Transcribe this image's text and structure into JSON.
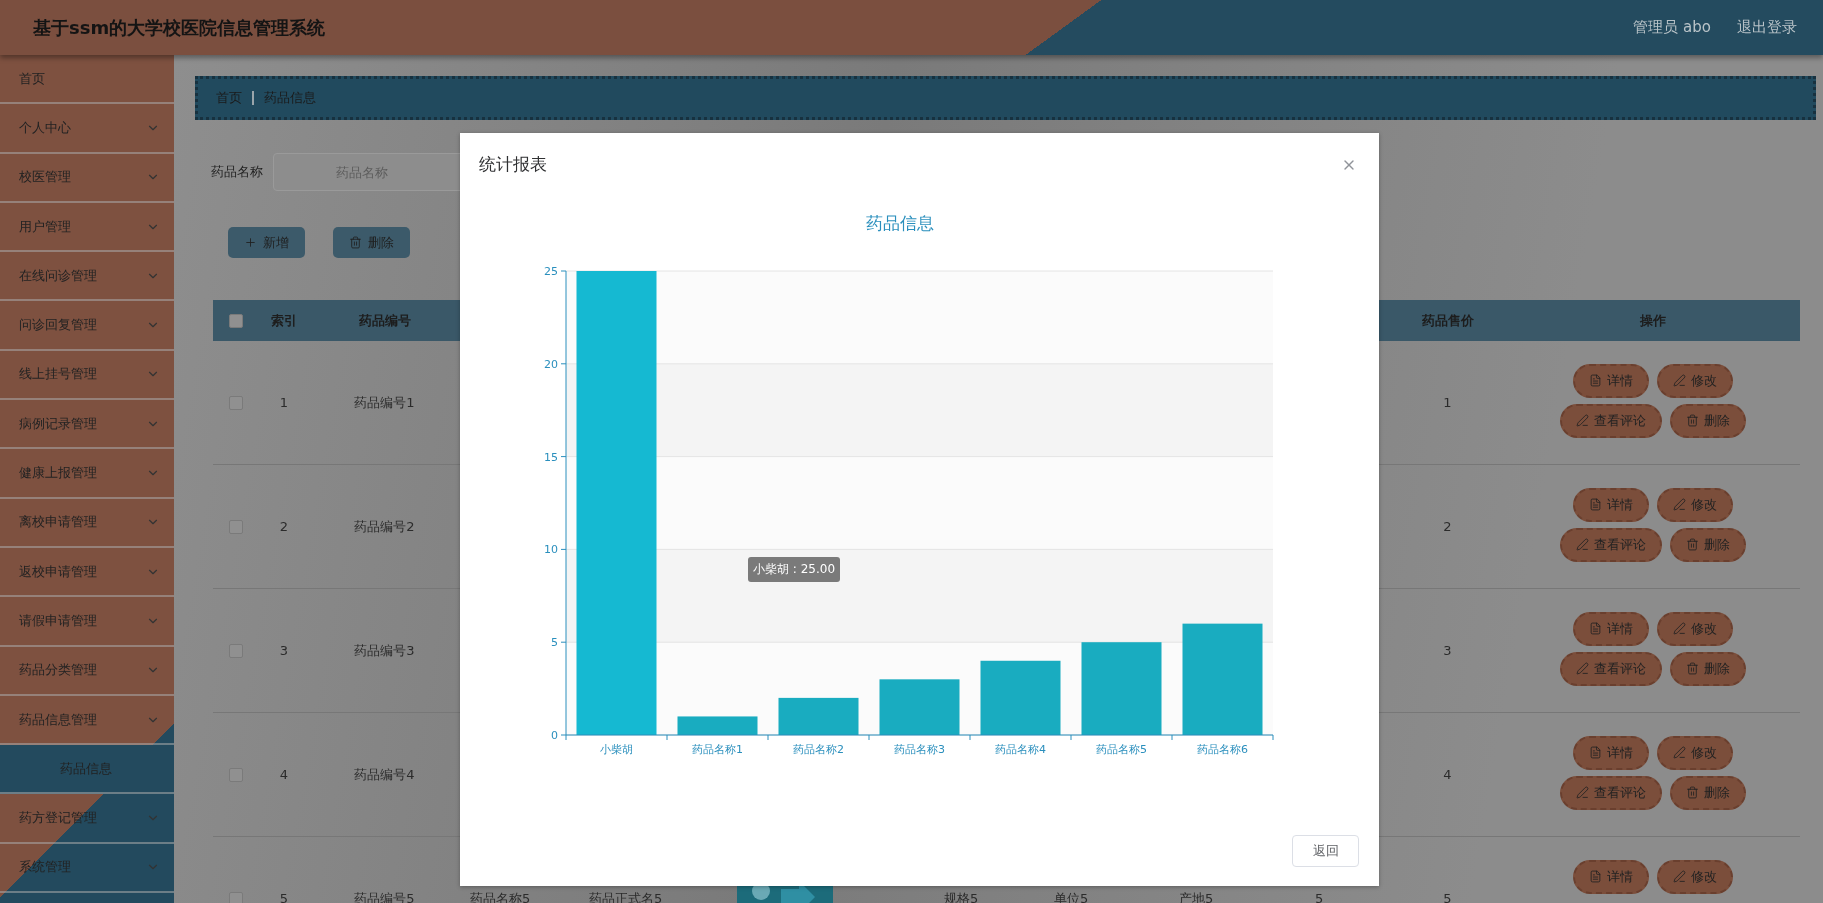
{
  "header": {
    "title": "基于ssm的大学校医院信息管理系统",
    "user": "管理员 abo",
    "logout": "退出登录"
  },
  "sidebar": {
    "items": [
      {
        "label": "首页",
        "kind": "link"
      },
      {
        "label": "个人中心",
        "kind": "menu"
      },
      {
        "label": "校医管理",
        "kind": "menu"
      },
      {
        "label": "用户管理",
        "kind": "menu"
      },
      {
        "label": "在线问诊管理",
        "kind": "menu"
      },
      {
        "label": "问诊回复管理",
        "kind": "menu"
      },
      {
        "label": "线上挂号管理",
        "kind": "menu"
      },
      {
        "label": "病例记录管理",
        "kind": "menu"
      },
      {
        "label": "健康上报管理",
        "kind": "menu"
      },
      {
        "label": "离校申请管理",
        "kind": "menu"
      },
      {
        "label": "返校申请管理",
        "kind": "menu"
      },
      {
        "label": "请假申请管理",
        "kind": "menu"
      },
      {
        "label": "药品分类管理",
        "kind": "menu"
      },
      {
        "label": "药品信息管理",
        "kind": "menu",
        "children": [
          {
            "label": "药品信息"
          }
        ]
      },
      {
        "label": "药方登记管理",
        "kind": "menu"
      },
      {
        "label": "系统管理",
        "kind": "menu"
      }
    ]
  },
  "breadcrumb": [
    "首页",
    "药品信息"
  ],
  "search": {
    "label": "药品名称",
    "placeholder": "药品名称"
  },
  "toolbar": [
    {
      "label": "新增",
      "kind": "add"
    },
    {
      "label": "删除",
      "kind": "delete"
    }
  ],
  "table": {
    "header_checked": false,
    "columns": {
      "index": "索引",
      "code": "药品编号",
      "price": "药品售价",
      "actions": "操作"
    },
    "rows": [
      {
        "checked": false,
        "index": "1",
        "code": "药品编号1",
        "price": "1",
        "actions": [
          {
            "label": "详情",
            "kind": "detail"
          },
          {
            "label": "修改",
            "kind": "edit"
          },
          {
            "label": "查看评论",
            "kind": "edit"
          },
          {
            "label": "删除",
            "kind": "delete"
          }
        ]
      },
      {
        "checked": false,
        "index": "2",
        "code": "药品编号2",
        "price": "2",
        "actions": [
          {
            "label": "详情",
            "kind": "detail"
          },
          {
            "label": "修改",
            "kind": "edit"
          },
          {
            "label": "查看评论",
            "kind": "edit"
          },
          {
            "label": "删除",
            "kind": "delete"
          }
        ]
      },
      {
        "checked": false,
        "index": "3",
        "code": "药品编号3",
        "price": "3",
        "actions": [
          {
            "label": "详情",
            "kind": "detail"
          },
          {
            "label": "修改",
            "kind": "edit"
          },
          {
            "label": "查看评论",
            "kind": "edit"
          },
          {
            "label": "删除",
            "kind": "delete"
          }
        ]
      },
      {
        "checked": false,
        "index": "4",
        "code": "药品编号4",
        "price": "4",
        "actions": [
          {
            "label": "详情",
            "kind": "detail"
          },
          {
            "label": "修改",
            "kind": "edit"
          },
          {
            "label": "查看评论",
            "kind": "edit"
          },
          {
            "label": "删除",
            "kind": "delete"
          }
        ]
      },
      {
        "checked": false,
        "index": "5",
        "code": "药品编号5",
        "column_3": "药品名称5",
        "column_4": "药品正式名5",
        "column_6": "规格5",
        "column_7": "单位5",
        "column_8": "产地5",
        "column_9": "5",
        "price": "5",
        "actions": [
          {
            "label": "详情",
            "kind": "detail"
          },
          {
            "label": "修改",
            "kind": "edit"
          }
        ]
      }
    ]
  },
  "modal": {
    "title": "统计报表",
    "tooltip": "小柴胡 : 25.00",
    "button": "返回",
    "chart_data": {
      "type": "bar",
      "title": "药品信息",
      "categories": [
        "小柴胡",
        "药品名称1",
        "药品名称2",
        "药品名称3",
        "药品名称4",
        "药品名称5",
        "药品名称6"
      ],
      "values": [
        25,
        1,
        2,
        3,
        4,
        5,
        6
      ],
      "ylim": [
        0,
        25
      ],
      "yticks": [
        0,
        5,
        10,
        15,
        20,
        25
      ],
      "grid": true
    }
  }
}
